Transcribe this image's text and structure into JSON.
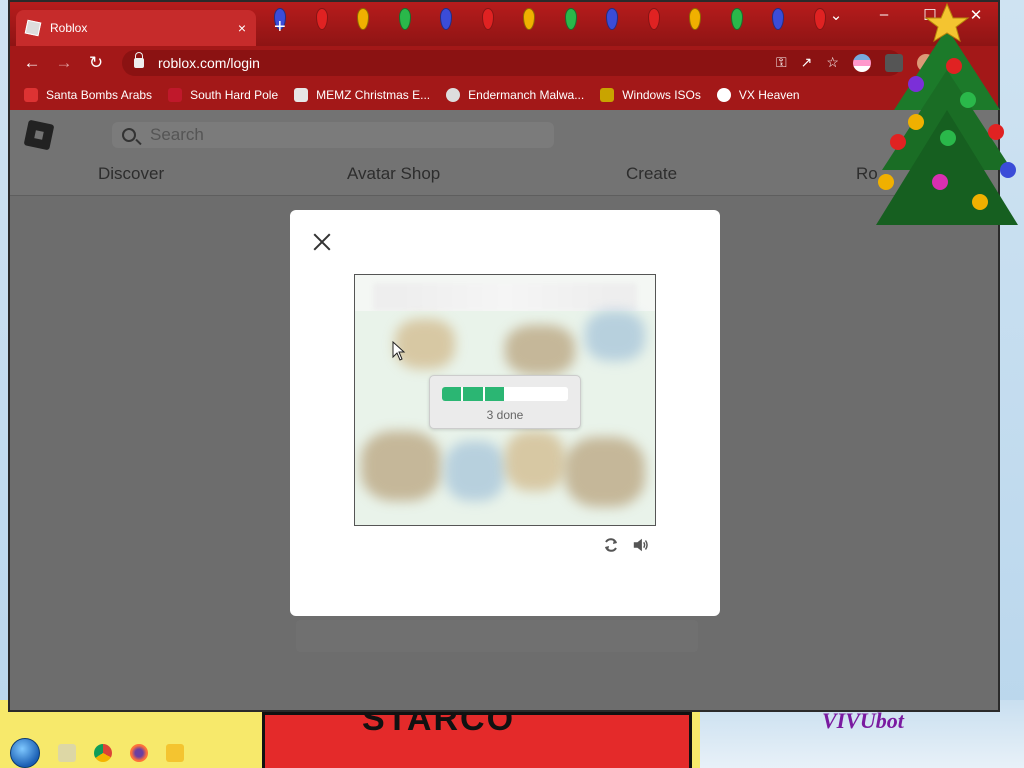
{
  "browser": {
    "tab": {
      "title": "Roblox",
      "close": "×"
    },
    "new_tab": "+",
    "window_controls": {
      "list": "⌄",
      "minimize": "–",
      "maximize": "☐",
      "close": "✕"
    },
    "url": "roblox.com/login",
    "bookmarks": [
      {
        "label": "Santa Bombs Arabs",
        "icon_color": "#d33"
      },
      {
        "label": "South Hard Pole",
        "icon_color": "#c0182b"
      },
      {
        "label": "MEMZ Christmas E...",
        "icon_color": "#e6e6e6"
      },
      {
        "label": "Endermanch Malwa...",
        "icon_color": "#dddddd"
      },
      {
        "label": "Windows ISOs",
        "icon_color": "#c9a400"
      },
      {
        "label": "VX Heaven",
        "icon_color": "#ffffff"
      }
    ]
  },
  "page": {
    "search_placeholder": "Search",
    "nav": [
      "Discover",
      "Avatar Shop",
      "Create",
      "Ro"
    ]
  },
  "captcha": {
    "progress_total_segments": 6,
    "progress_done_segments": 3,
    "progress_label": "3 done"
  },
  "desktop": {
    "banner_text": "STARCO",
    "right_text": "VIVUbot"
  },
  "colors": {
    "chrome_red": "#a31818",
    "progress_green": "#2bb673",
    "overlay_gray": "#6d6d6d"
  },
  "icons": {
    "close": "close-icon",
    "refresh": "refresh-icon",
    "audio": "speaker-icon",
    "search": "search-icon"
  }
}
